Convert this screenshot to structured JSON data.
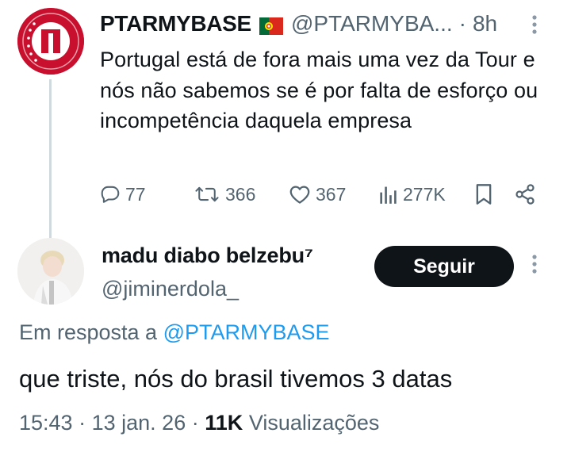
{
  "parent_tweet": {
    "author_name": "PTARMYBASE",
    "flag_icon": "portugal-flag-icon",
    "handle": "@PTARMYBA...",
    "separator": "·",
    "time": "8h",
    "text": "Portugal está de fora mais uma vez da Tour e nós não sabemos se é por falta de esforço ou incompetência daquela empresa",
    "stats": {
      "replies": "77",
      "retweets": "366",
      "likes": "367",
      "views": "277K"
    },
    "colors": {
      "avatar": "#c8102e"
    }
  },
  "reply_tweet": {
    "author_name": "madu diabo belzebu⁷",
    "handle": "@jiminerdola_",
    "follow_label": "Seguir",
    "replying_prefix": "Em resposta a",
    "replying_to": "@PTARMYBASE",
    "text": "que triste, nós do brasil tivemos 3 datas",
    "meta": {
      "time": "15:43",
      "date": "13 jan. 26",
      "separator": "·",
      "views_count": "11K",
      "views_label": "Visualizações"
    }
  },
  "colors": {
    "text_primary": "#0f1419",
    "text_secondary": "#536471",
    "link": "#1d9bf0",
    "button_bg": "#0f1419",
    "thread_line": "#cfd9de"
  }
}
